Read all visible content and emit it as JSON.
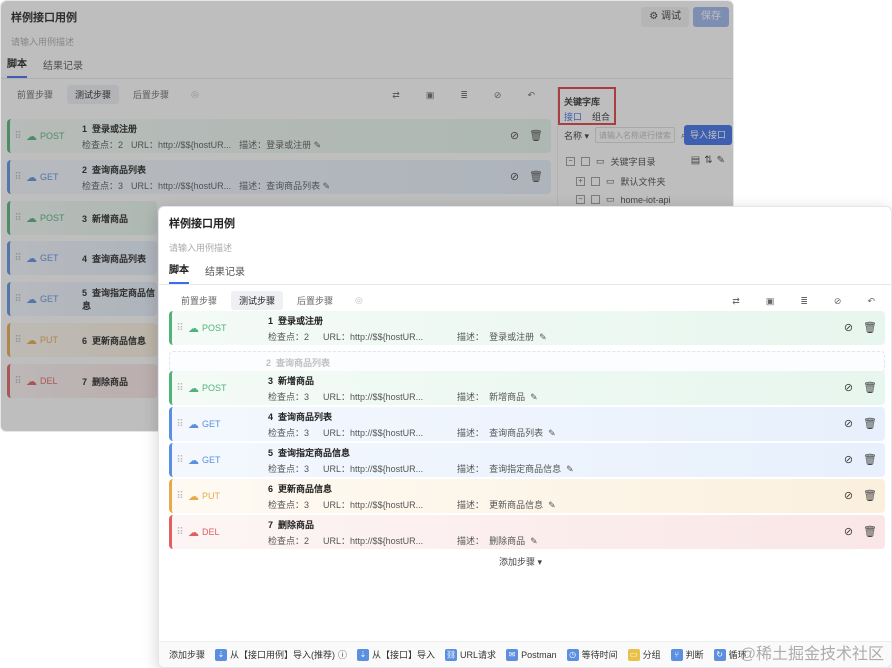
{
  "title": "样例接口用例",
  "subtitle": "请输入用例描述",
  "header": {
    "debug_label": "调试",
    "save_label": "保存"
  },
  "tabs": [
    "脚本",
    "结果记录"
  ],
  "subtabs": [
    "前置步骤",
    "测试步骤",
    "后置步骤"
  ],
  "labels": {
    "checks": "检查点：",
    "url": "URL：",
    "desc": "描述："
  },
  "steps": [
    {
      "method": "POST",
      "index": "1",
      "name": "登录或注册",
      "checks": "2",
      "url": "http://$${hostUR...",
      "desc": "登录或注册"
    },
    {
      "method": "GET",
      "index": "2",
      "name": "查询商品列表",
      "checks": "3",
      "url": "http://$${hostUR...",
      "desc": "查询商品列表"
    },
    {
      "method": "POST",
      "index": "3",
      "name": "新增商品",
      "checks": "3",
      "url": "http://$${hostUR...",
      "desc": "新增商品"
    },
    {
      "method": "GET",
      "index": "4",
      "name": "查询商品列表",
      "checks": "3",
      "url": "http://$${hostUR...",
      "desc": "查询商品列表"
    },
    {
      "method": "GET",
      "index": "5",
      "name": "查询指定商品信息",
      "checks": "3",
      "url": "http://$${hostUR...",
      "desc": "查询指定商品信息"
    },
    {
      "method": "PUT",
      "index": "6",
      "name": "更新商品信息",
      "checks": "3",
      "url": "http://$${hostUR...",
      "desc": "更新商品信息"
    },
    {
      "method": "DEL",
      "index": "7",
      "name": "删除商品",
      "checks": "2",
      "url": "http://$${hostUR...",
      "desc": "删除商品"
    }
  ],
  "library": {
    "title": "关键字库",
    "tabs": [
      "接口",
      "组合"
    ],
    "filter_label": "名称",
    "search_placeholder": "请输入名称进行搜索",
    "import_label": "导入接口",
    "tree": [
      "关键字目录",
      "默认文件夹",
      "home-iot-api"
    ]
  },
  "add_step": "添加步骤",
  "bottom": {
    "label": "添加步骤",
    "items": [
      "从【接口用例】导入(推荐)",
      "从【接口】导入",
      "URL请求",
      "Postman",
      "等待时间",
      "分组",
      "判断",
      "循环"
    ]
  },
  "watermark": "@稀土掘金技术社区"
}
